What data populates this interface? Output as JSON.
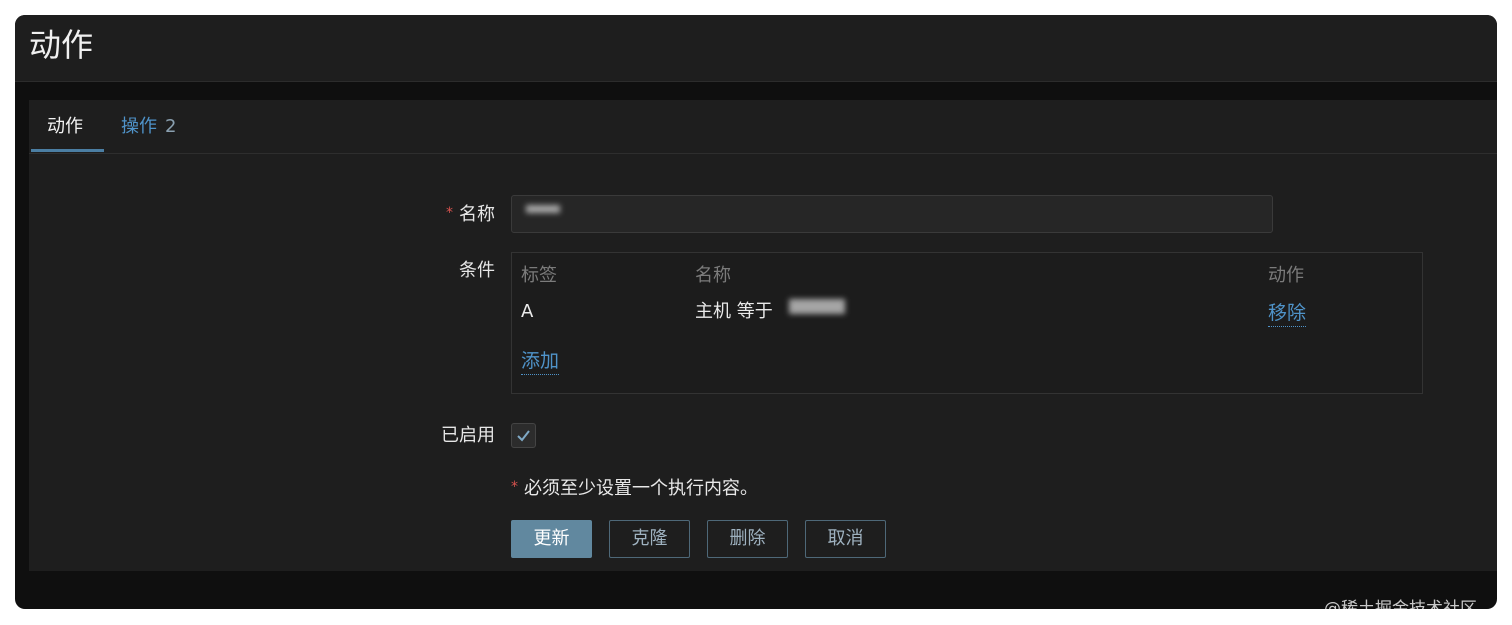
{
  "page": {
    "title": "动作"
  },
  "tabs": [
    {
      "label": "动作",
      "active": true
    },
    {
      "label": "操作",
      "count": "2",
      "active": false
    }
  ],
  "form": {
    "name_label": "名称",
    "required_mark": "*",
    "conditions_label": "条件",
    "conditions": {
      "headers": {
        "tag": "标签",
        "name": "名称",
        "action": "动作"
      },
      "rows": [
        {
          "tag": "A",
          "name": "主机 等于",
          "action": "移除"
        }
      ],
      "add_label": "添加"
    },
    "enabled_label": "已启用",
    "enabled": true,
    "notice": "必须至少设置一个执行内容。"
  },
  "buttons": {
    "update": "更新",
    "clone": "克隆",
    "delete": "删除",
    "cancel": "取消"
  },
  "watermark": "@稀土掘金技术社区",
  "colors": {
    "accent": "#4f93c9",
    "primary_button": "#61889f",
    "required": "#d9534f",
    "background": "#1e1e1e"
  }
}
